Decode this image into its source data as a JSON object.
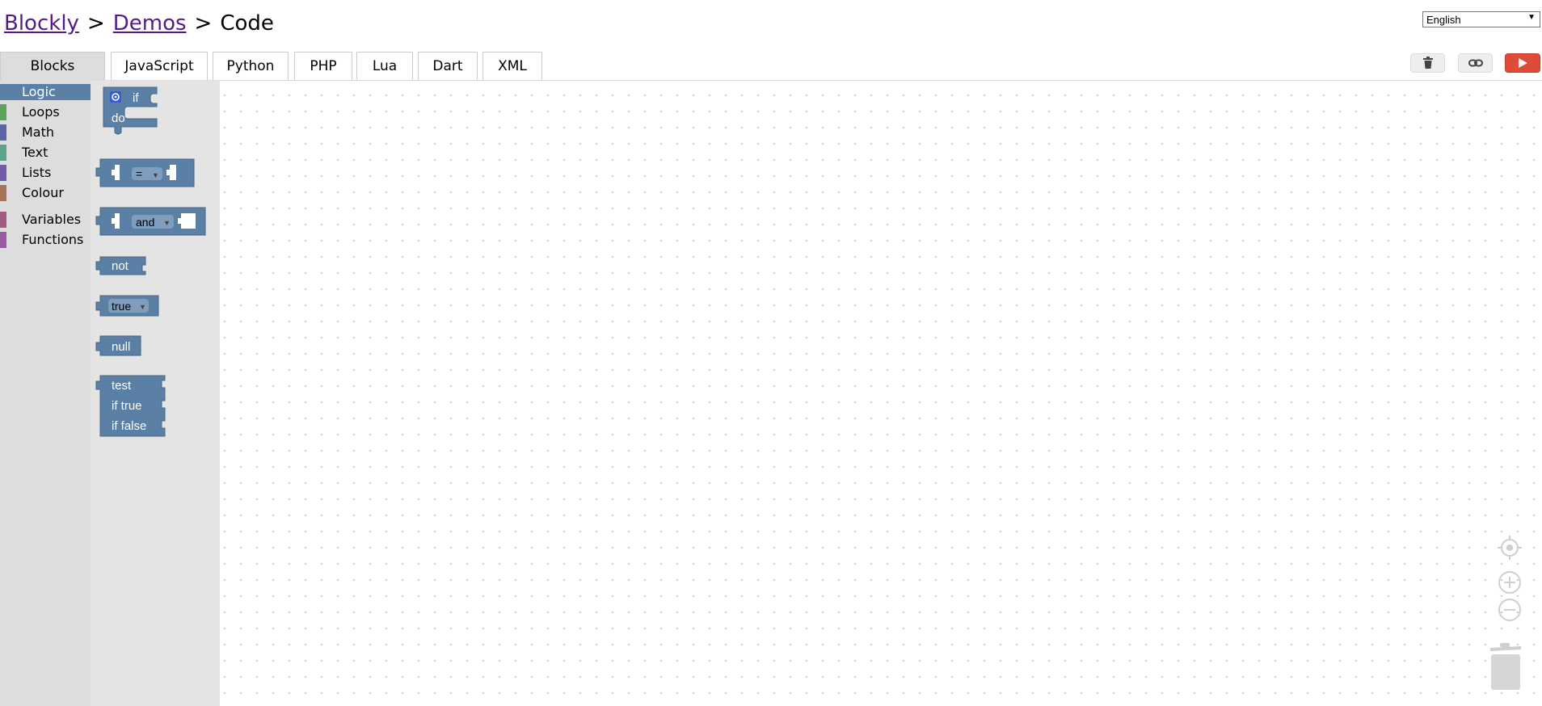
{
  "breadcrumb": {
    "link1": "Blockly",
    "link2": "Demos",
    "separator": ">",
    "current": "Code"
  },
  "language_select": {
    "value": "English"
  },
  "tabs": [
    {
      "label": "Blocks",
      "active": true
    },
    {
      "label": "JavaScript"
    },
    {
      "label": "Python"
    },
    {
      "label": "PHP"
    },
    {
      "label": "Lua"
    },
    {
      "label": "Dart"
    },
    {
      "label": "XML"
    }
  ],
  "toolbar": {
    "trash_icon": "trash-icon",
    "link_icon": "link-icon",
    "run_icon": "play-icon"
  },
  "toolbox": {
    "categories": [
      {
        "label": "Logic",
        "color": "#5b80a5",
        "selected": true
      },
      {
        "label": "Loops",
        "color": "#5ba55b"
      },
      {
        "label": "Math",
        "color": "#5b67a5"
      },
      {
        "label": "Text",
        "color": "#5ba58c"
      },
      {
        "label": "Lists",
        "color": "#745ba5"
      },
      {
        "label": "Colour",
        "color": "#a5745b"
      },
      {
        "label": "Variables",
        "color": "#a55b80"
      },
      {
        "label": "Functions",
        "color": "#995ba5"
      }
    ]
  },
  "flyout": {
    "block_color": "#5b80a5",
    "if_block": {
      "if": "if",
      "do": "do"
    },
    "compare_block": {
      "op": "="
    },
    "operation_block": {
      "op": "and"
    },
    "negate_block": {
      "label": "not"
    },
    "boolean_block": {
      "value": "true"
    },
    "null_block": {
      "label": "null"
    },
    "ternary_block": {
      "test": "test",
      "if_true": "if true",
      "if_false": "if false"
    }
  }
}
